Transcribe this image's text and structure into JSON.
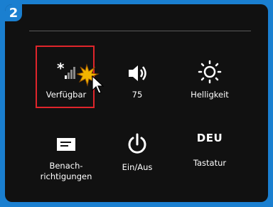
{
  "step_badge": "2",
  "tiles": [
    {
      "label": "Verfügbar",
      "icon": "network-signal-icon"
    },
    {
      "label": "75",
      "icon": "volume-icon"
    },
    {
      "label": "Helligkeit",
      "icon": "brightness-icon"
    },
    {
      "label": "Benach-\nrichtigungen",
      "icon": "notifications-icon"
    },
    {
      "label": "Ein/Aus",
      "icon": "power-icon"
    },
    {
      "label": "Tastatur",
      "icon_text": "DEU"
    }
  ],
  "colors": {
    "background": "#1a7fd0",
    "panel": "#111111",
    "highlight": "#e0252b",
    "text": "#ffffff"
  }
}
